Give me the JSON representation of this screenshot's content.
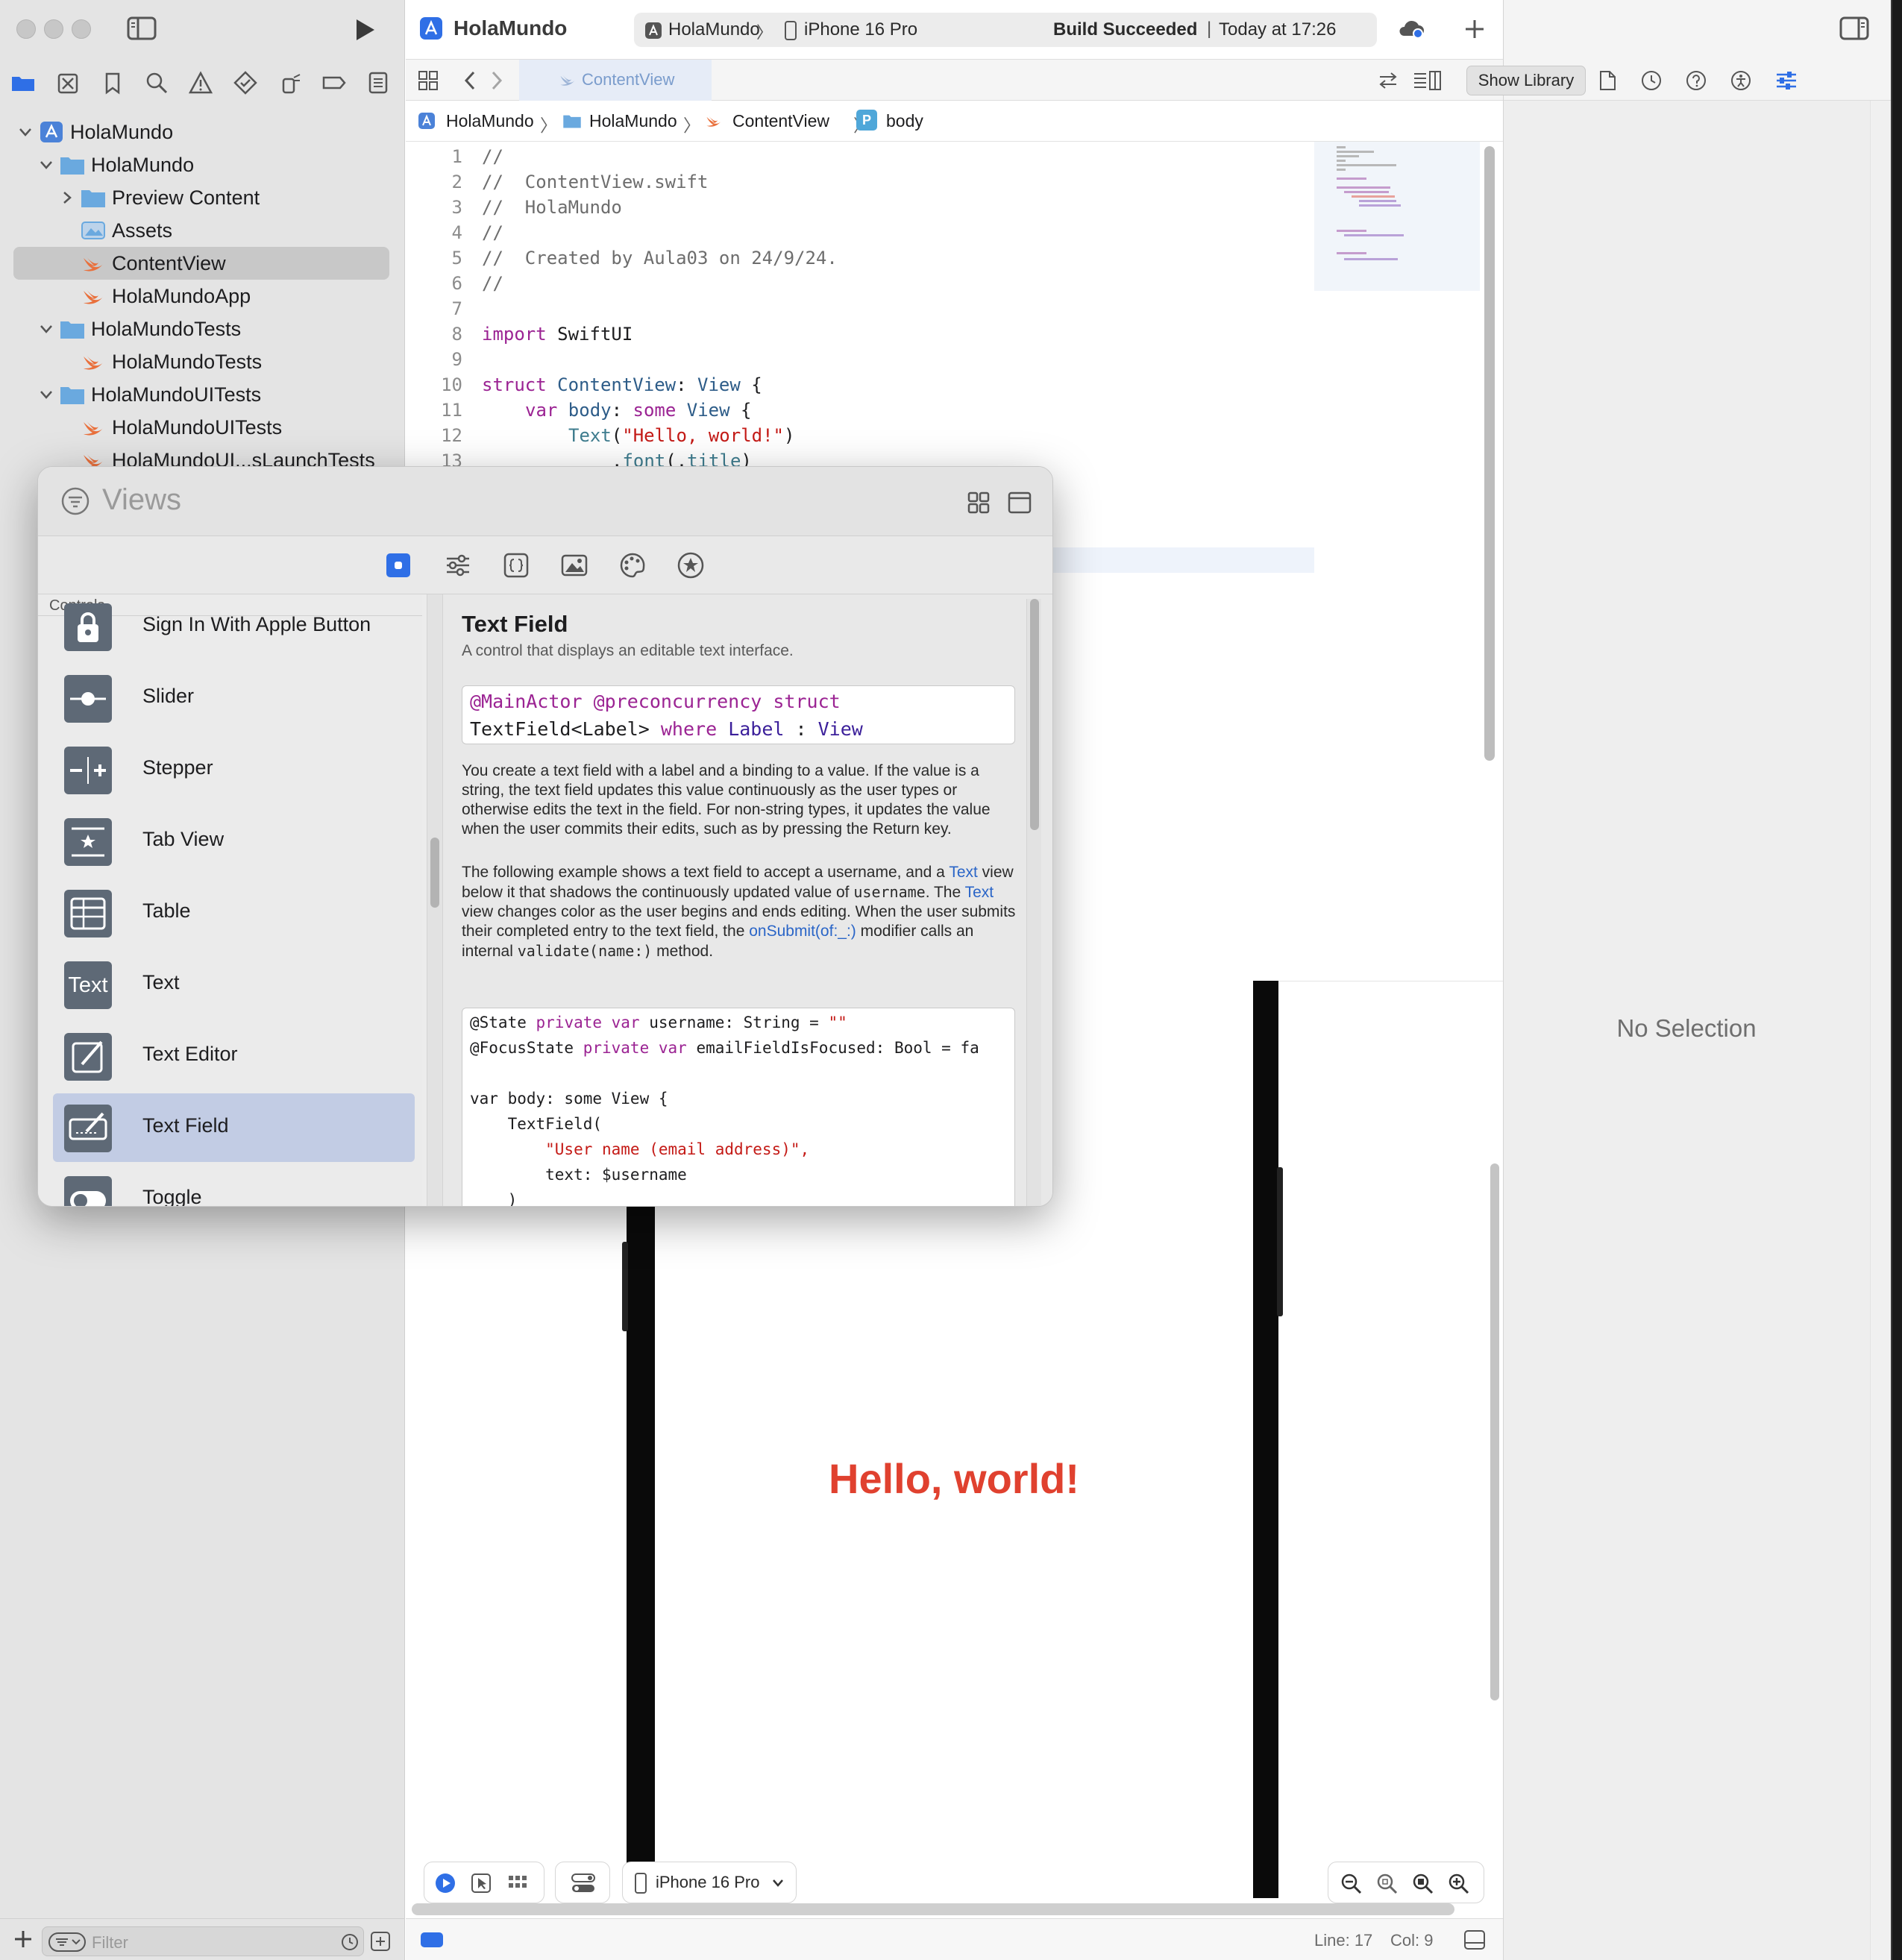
{
  "colors": {
    "accent": "#2f6fe6",
    "swift_orange": "#e9703c",
    "folder_blue": "#6aa9df",
    "hello_red": "#e0412f"
  },
  "toolbar": {
    "project_name": "HolaMundo",
    "scheme": "HolaMundo",
    "scheme_sep": "〉",
    "device": "iPhone 16 Pro",
    "build_status_bold": "Build Succeeded",
    "build_status_sep": "|",
    "build_time": "Today at 17:26"
  },
  "tabbar": {
    "active_tab": "ContentView"
  },
  "jumpbar": {
    "items": [
      "HolaMundo",
      "HolaMundo",
      "ContentView",
      "body"
    ],
    "sep": "〉",
    "body_badge": "P"
  },
  "navigator": {
    "tree": [
      {
        "label": "HolaMundo",
        "kind": "project"
      },
      {
        "label": "HolaMundo",
        "kind": "folder"
      },
      {
        "label": "Preview Content",
        "kind": "folder"
      },
      {
        "label": "Assets",
        "kind": "assets"
      },
      {
        "label": "ContentView",
        "kind": "swift",
        "selected": true
      },
      {
        "label": "HolaMundoApp",
        "kind": "swift"
      },
      {
        "label": "HolaMundoTests",
        "kind": "folder"
      },
      {
        "label": "HolaMundoTests",
        "kind": "swift"
      },
      {
        "label": "HolaMundoUITests",
        "kind": "folder"
      },
      {
        "label": "HolaMundoUITests",
        "kind": "swift"
      },
      {
        "label": "HolaMundoUI...sLaunchTests",
        "kind": "swift"
      }
    ],
    "filter_placeholder": "Filter"
  },
  "editor": {
    "line_numbers": [
      "1",
      "2",
      "3",
      "4",
      "5",
      "6",
      "7",
      "8",
      "9",
      "10",
      "11",
      "12",
      "13"
    ],
    "lines": {
      "l1": "//",
      "l2": "//  ContentView.swift",
      "l3": "//  HolaMundo",
      "l4": "//",
      "l5": "//  Created by Aula03 on 24/9/24.",
      "l6": "//",
      "l8_kw": "import",
      "l8_rest": " SwiftUI",
      "l10_kw": "struct",
      "l10_name": " ContentView",
      "l10_colon": ": ",
      "l10_type": "View",
      "l10_brace": " {",
      "l11_kw": "var",
      "l11_name": " body",
      "l11_colon": ": ",
      "l11_kw2": "some",
      "l11_type": " View",
      "l11_brace": " {",
      "l12_fn": "Text",
      "l12_open": "(",
      "l12_str": "\"Hello, world!\"",
      "l12_close": ")",
      "l13_dot": ".",
      "l13_fn": "font",
      "l13_open": "(.",
      "l13_arg": "title",
      "l13_close": ")"
    }
  },
  "preview": {
    "hello_text": "Hello, world!",
    "device": "iPhone 16 Pro"
  },
  "statusbar": {
    "line": "Line: 17",
    "col": "Col: 9"
  },
  "inspector": {
    "tooltip": "Show Library",
    "no_selection": "No Selection"
  },
  "library": {
    "search_placeholder": "Views",
    "section": "Controls",
    "items": [
      {
        "name": "Sign In With Apple Button",
        "icon": "lock-icon"
      },
      {
        "name": "Slider",
        "icon": "slider-icon"
      },
      {
        "name": "Stepper",
        "icon": "stepper-icon"
      },
      {
        "name": "Tab View",
        "icon": "tab-view-icon"
      },
      {
        "name": "Table",
        "icon": "table-icon"
      },
      {
        "name": "Text",
        "icon": "text-icon",
        "tile_text": "Text"
      },
      {
        "name": "Text Editor",
        "icon": "text-editor-icon"
      },
      {
        "name": "Text Field",
        "icon": "text-field-icon",
        "selected": true
      },
      {
        "name": "Toggle",
        "icon": "toggle-icon"
      }
    ],
    "detail": {
      "title": "Text Field",
      "subtitle": "A control that displays an editable text interface.",
      "decl_kw1": "@MainActor @preconcurrency struct",
      "decl_name": "TextField<Label>",
      "decl_where": " where ",
      "decl_label": "Label",
      "decl_colon": " : ",
      "decl_view": "View",
      "para1": "You create a text field with a label and a binding to a value. If the value is a string, the text field updates this value continuously as the user types or otherwise edits the text in the field. For non-string types, it updates the value when the user commits their edits, such as by pressing the Return key.",
      "para2_a": "The following example shows a text field to accept a username, and a ",
      "para2_link1": "Text",
      "para2_b": " view below it that shadows the continuously updated value of ",
      "para2_code1": "username",
      "para2_c": ". The ",
      "para2_link2": "Text",
      "para2_d": " view changes color as the user begins and ends editing. When the user submits their completed entry to the text field, the ",
      "para2_link3": "onSubmit(of:_:)",
      "para2_e": " modifier calls an internal ",
      "para2_code2": "validate(name:)",
      "para2_f": " method.",
      "example": {
        "e1_a": "@State ",
        "e1_kw": "private var",
        "e1_b": " username: String = ",
        "e1_str": "\"\"",
        "e2_a": "@FocusState ",
        "e2_kw": "private var",
        "e2_b": " emailFieldIsFocused: Bool = fa",
        "e4": "var body: some View {",
        "e5": "    TextField(",
        "e6": "        \"User name (email address)\",",
        "e7": "        text: $username",
        "e8": "    )"
      }
    }
  }
}
